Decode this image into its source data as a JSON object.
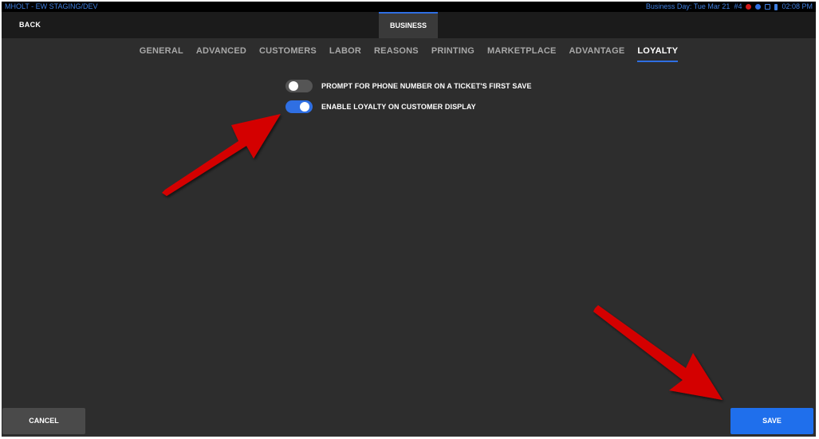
{
  "status_bar": {
    "left_text": "MHOLT - EW STAGING/DEV",
    "business_day": "Business Day: Tue Mar 21",
    "terminal": "#4",
    "time": "02:08 PM"
  },
  "header": {
    "back_label": "BACK",
    "tab_label": "BUSINESS"
  },
  "subtabs": [
    {
      "label": "GENERAL"
    },
    {
      "label": "ADVANCED"
    },
    {
      "label": "CUSTOMERS"
    },
    {
      "label": "LABOR"
    },
    {
      "label": "REASONS"
    },
    {
      "label": "PRINTING"
    },
    {
      "label": "MARKETPLACE"
    },
    {
      "label": "ADVANTAGE"
    },
    {
      "label": "LOYALTY"
    }
  ],
  "active_subtab": "LOYALTY",
  "settings": [
    {
      "label": "PROMPT FOR PHONE NUMBER ON A TICKET'S FIRST SAVE",
      "enabled": false
    },
    {
      "label": "ENABLE LOYALTY ON CUSTOMER DISPLAY",
      "enabled": true
    }
  ],
  "footer": {
    "cancel_label": "CANCEL",
    "save_label": "SAVE"
  },
  "colors": {
    "accent": "#2f6fe3",
    "save_button": "#1f6fec",
    "background": "#2d2d2d",
    "annotation_arrow": "#cc0000"
  }
}
